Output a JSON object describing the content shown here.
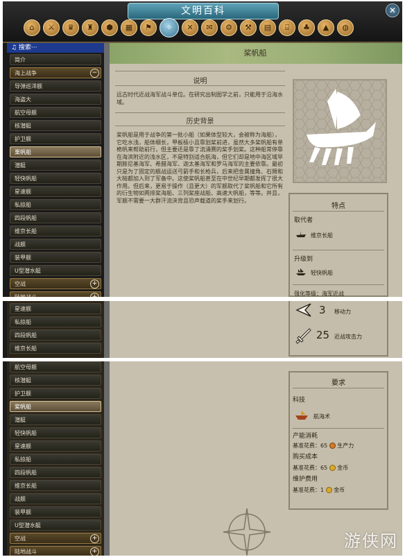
{
  "window": {
    "title": "文明百科",
    "close_glyph": "✕"
  },
  "icon_bar": [
    "home-icon",
    "sword-icon",
    "crown-icon",
    "tower-icon",
    "hex-icon",
    "city-icon",
    "flag-icon",
    "compass-icon",
    "crossed-swords-icon",
    "scroll-icon",
    "gear-icon",
    "hammer-icon",
    "library-icon",
    "bank-icon",
    "forest-icon",
    "mountain-icon",
    "globe-icon"
  ],
  "sidebar": {
    "search_label": "♫ 搜索···",
    "panel1_items": [
      "简介",
      "海上战争",
      "导弹巡洋舰",
      "海盗大",
      "航空母舰",
      "核潜艇",
      "护卫舰",
      "栗帆船",
      "潜艇",
      "轻快帆船",
      "星速舰",
      "私掠船",
      "四段帆船",
      "维京长船",
      "战舰",
      "装甲舰",
      "U型潜水艇",
      "空战",
      "陆地战斗"
    ],
    "panel2_items": [
      "星速舰",
      "私掠船",
      "四段帆船",
      "维京长船"
    ],
    "panel3_items": [
      "航空母舰",
      "核潜艇",
      "护卫舰",
      "桨帆船",
      "潜艇",
      "轻快帆船",
      "星速舰",
      "私掠船",
      "四段帆船",
      "维京长船",
      "战舰",
      "装甲舰",
      "U型潜水艇",
      "空战",
      "陆地战斗"
    ]
  },
  "page": {
    "title": "桨帆船",
    "summary_title": "说明",
    "summary_text": "远古时代近战海军战斗单位。在研究出制图学之前，只能用于沿海水域。",
    "history_title": "历史背景",
    "history_text": "桨帆船是用于战争的第一批小船（如果体型较大，会被称为海船），它吃水浅，船体细长，甲板极小且靠划桨前进，虽然大多桨帆船有单桅帆来帮助前行，但主要还是靠了流涌赛的桨手划桨。这种船常停靠在海滨附近的浅水区，不是特别适合航海，但它们却是地中海区域早期腓尼基海军、希腊海军、迦太基海军和罗马海军的主要依靠。最初只是为了固定的舰战运送弓箭手和长枪兵，后来把金属撞角、石臂和大槌都加入到了军备中。这使桨帆船甚至在中世纪早期都发挥了很大作用。但后来，更易于操作（且更大）的军舰取代了桨帆船和它所有的衍生物如两排桨海船、三列桨座战船、高速大帆船，等等。并且，军舰不需要一大群汗流浃背且恐声载道的桨手来划行。"
  },
  "features": {
    "title": "特点",
    "replaced_by_label": "取代者",
    "replaced_by_value": "维京长船",
    "upgrade_label": "升级到",
    "upgrade_value": "轻快帆船",
    "strength_label": "强化等级：海军近战",
    "moves_value": "3",
    "moves_label": "移动力",
    "strength_value": "25",
    "strength_stat_label": "近战攻击力"
  },
  "requirements": {
    "title": "要求",
    "tech_label": "科技",
    "tech_value": "航海术",
    "production_label": "产能消耗",
    "production_cost": "基准花费：65",
    "production_unit": "生产力",
    "buy_label": "购买成本",
    "buy_cost": "基准花费：65",
    "buy_unit": "金币",
    "maint_label": "维护费用",
    "maint_cost": "基准花费：1",
    "maint_unit": "金币"
  },
  "watermark": "游侠网",
  "colors": {
    "title_teal": "#3c86a0",
    "search_blue": "#1e3a8f",
    "parchment": "#c8c0ae",
    "item_gold": "#9a7a44"
  }
}
